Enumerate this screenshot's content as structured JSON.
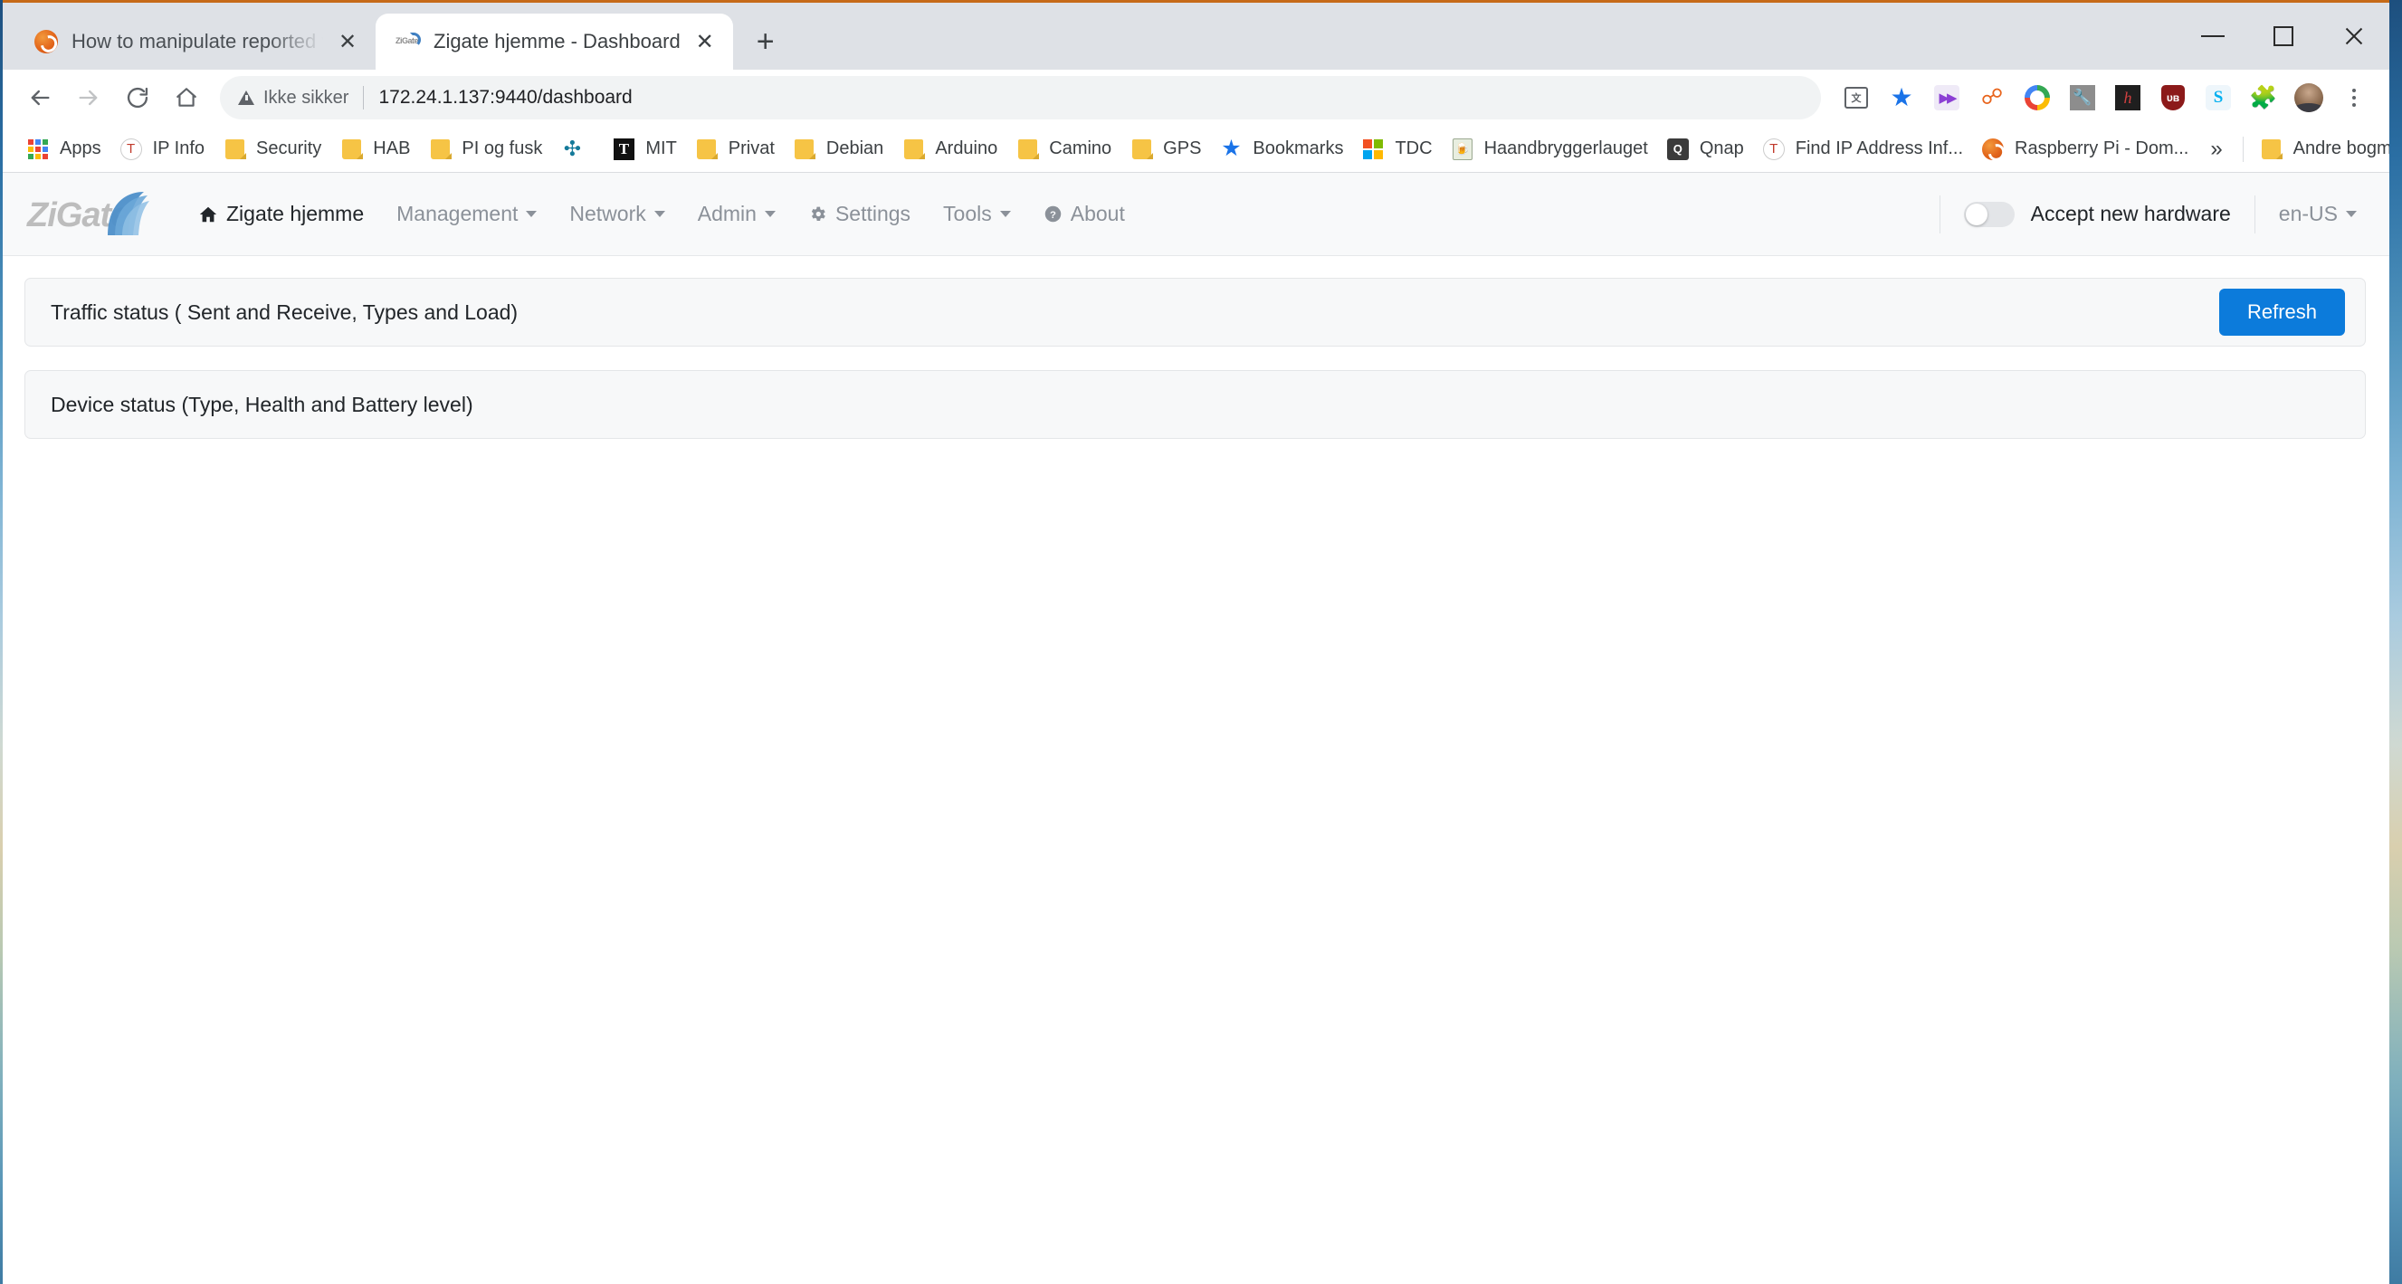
{
  "browser": {
    "tabs": [
      {
        "title": "How to manipulate reported valu",
        "favicon": "orange-circle-icon",
        "active": false
      },
      {
        "title": "Zigate hjemme - Dashboard",
        "favicon": "zigate-icon",
        "active": true
      }
    ],
    "new_tab_label": "+",
    "window_controls": {
      "minimize": "minimize-icon",
      "maximize": "maximize-icon",
      "close": "close-icon"
    },
    "navigation": {
      "back": "back-arrow-icon",
      "forward": "forward-arrow-icon",
      "reload": "reload-icon",
      "home": "home-icon"
    },
    "omnibox": {
      "security_label": "Ikke sikker",
      "security_icon": "warning-triangle-icon",
      "url": "172.24.1.137:9440/dashboard"
    },
    "toolbar_icons": [
      "translate-icon",
      "bookmark-star-icon",
      "fast-forward-extension-icon",
      "radio-tower-extension-icon",
      "color-circle-extension-icon",
      "wrench-extension-icon",
      "h-extension-icon",
      "ublock-shield-icon",
      "skype-icon",
      "puzzle-extensions-icon",
      "profile-avatar",
      "chrome-menu-icon"
    ],
    "bookmarks": [
      {
        "label": "Apps",
        "icon": "apps-grid-icon"
      },
      {
        "label": "IP Info",
        "icon": "tesla-icon"
      },
      {
        "label": "Security",
        "icon": "folder-icon"
      },
      {
        "label": "HAB",
        "icon": "folder-icon"
      },
      {
        "label": "PI og fusk",
        "icon": "folder-icon"
      },
      {
        "label": "",
        "icon": "xbird-icon"
      },
      {
        "label": "MIT",
        "icon": "mit-icon"
      },
      {
        "label": "Privat",
        "icon": "folder-icon"
      },
      {
        "label": "Debian",
        "icon": "folder-icon"
      },
      {
        "label": "Arduino",
        "icon": "folder-icon"
      },
      {
        "label": "Camino",
        "icon": "folder-icon"
      },
      {
        "label": "GPS",
        "icon": "folder-icon"
      },
      {
        "label": "Bookmarks",
        "icon": "blue-star-icon"
      },
      {
        "label": "TDC",
        "icon": "microsoft-squares-icon"
      },
      {
        "label": "Haandbryggerlauget",
        "icon": "beer-bottle-icon"
      },
      {
        "label": "Qnap",
        "icon": "qnap-icon"
      },
      {
        "label": "Find IP Address Inf...",
        "icon": "tesla-icon"
      },
      {
        "label": "Raspberry Pi - Dom...",
        "icon": "orange-circle-icon"
      }
    ],
    "bookmarks_overflow": "»",
    "other_bookmarks": {
      "label": "Andre bogmærker",
      "icon": "folder-icon"
    }
  },
  "site": {
    "brand": {
      "text": "ZiGate",
      "swoosh_color": "#3f7fc1",
      "text_color": "#bdbdbd"
    },
    "nav": [
      {
        "label": "Zigate hjemme",
        "icon": "home-icon",
        "has_caret": false,
        "active": true
      },
      {
        "label": "Management",
        "icon": null,
        "has_caret": true,
        "active": false
      },
      {
        "label": "Network",
        "icon": null,
        "has_caret": true,
        "active": false
      },
      {
        "label": "Admin",
        "icon": null,
        "has_caret": true,
        "active": false
      },
      {
        "label": "Settings",
        "icon": "gear-icon",
        "has_caret": false,
        "active": false
      },
      {
        "label": "Tools",
        "icon": null,
        "has_caret": true,
        "active": false
      },
      {
        "label": "About",
        "icon": "question-circle-icon",
        "has_caret": false,
        "active": false
      }
    ],
    "accept_hardware": {
      "label": "Accept new hardware",
      "enabled": false
    },
    "language": {
      "value": "en-US"
    },
    "panels": [
      {
        "title": "Traffic status ( Sent and Receive, Types and Load)",
        "action": "Refresh"
      },
      {
        "title": "Device status (Type, Health and Battery level)",
        "action": null
      }
    ],
    "accent_color": "#0c7bdb"
  }
}
